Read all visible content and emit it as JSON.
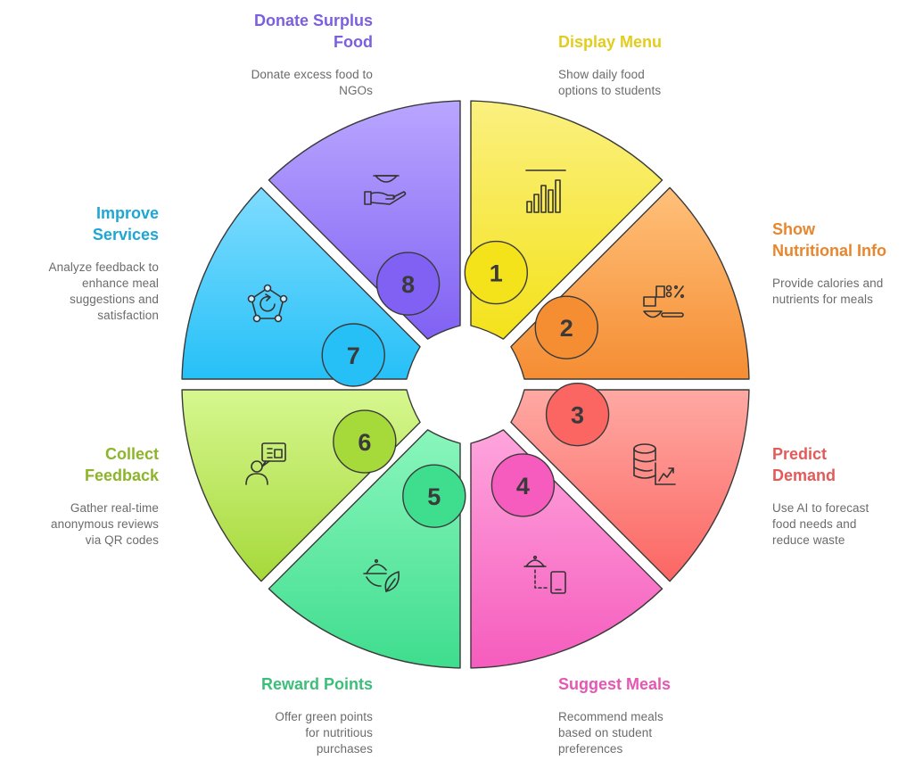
{
  "steps": [
    {
      "number": "1",
      "title": "Display Menu",
      "description": "Show daily food options to students",
      "icon": "bar-chart-icon",
      "color": "#e3cc1e",
      "fill_top": "#fbf080",
      "fill_bottom": "#f4e21a"
    },
    {
      "number": "2",
      "title": "Show Nutritional Info",
      "description": "Provide calories and nutrients for meals",
      "icon": "nutrition-scale-icon",
      "color": "#e8862e",
      "fill_top": "#ffc07a",
      "fill_bottom": "#f58d33"
    },
    {
      "number": "3",
      "title": "Predict Demand",
      "description": "Use AI to forecast food needs and reduce waste",
      "icon": "database-trend-icon",
      "color": "#e35b58",
      "fill_top": "#ffa9a3",
      "fill_bottom": "#fb6663"
    },
    {
      "number": "4",
      "title": "Suggest Meals",
      "description": "Recommend meals based on student preferences",
      "icon": "food-phone-icon",
      "color": "#e457b3",
      "fill_top": "#ffa5dd",
      "fill_bottom": "#f55cbd"
    },
    {
      "number": "5",
      "title": "Reward Points",
      "description": "Offer green points for nutritious purchases",
      "icon": "eco-food-icon",
      "color": "#3bbf78",
      "fill_top": "#8af6bc",
      "fill_bottom": "#3fdd8e"
    },
    {
      "number": "6",
      "title": "Collect Feedback",
      "description": "Gather real-time anonymous reviews via QR codes",
      "icon": "feedback-person-icon",
      "color": "#8cb52a",
      "fill_top": "#d6f78f",
      "fill_bottom": "#a6d93a"
    },
    {
      "number": "7",
      "title": "Improve Services",
      "description": "Analyze feedback to enhance meal suggestions and satisfaction",
      "icon": "cycle-network-icon",
      "color": "#1ea6d4",
      "fill_top": "#7fdcff",
      "fill_bottom": "#26c0f7"
    },
    {
      "number": "8",
      "title": "Donate Surplus Food",
      "description": "Donate excess food to NGOs",
      "icon": "bowl-hand-icon",
      "color": "#7b5fe0",
      "fill_top": "#b9a6ff",
      "fill_bottom": "#8061f3"
    }
  ]
}
